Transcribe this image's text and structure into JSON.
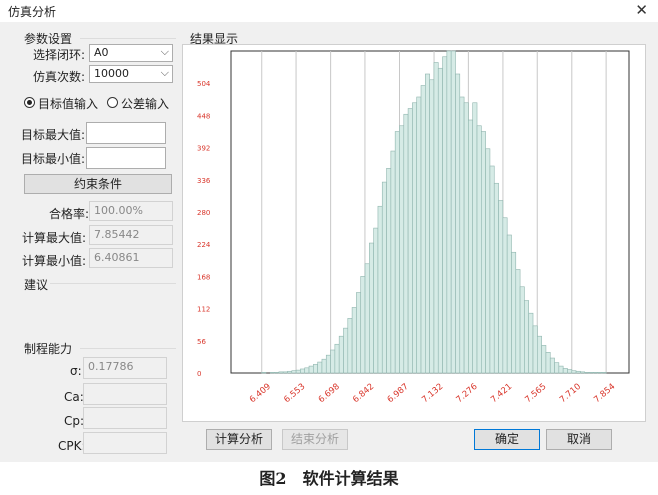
{
  "window": {
    "title": "仿真分析"
  },
  "params": {
    "heading": "参数设置",
    "loop_label": "选择闭环:",
    "loop_value": "A0",
    "count_label": "仿真次数:",
    "count_value": "10000",
    "radio_target": "目标值输入",
    "radio_tolerance": "公差输入",
    "target_max_label": "目标最大值:",
    "target_min_label": "目标最小值:",
    "constraint_button": "约束条件",
    "pass_rate_label": "合格率:",
    "pass_rate_value": "100.00%",
    "calc_max_label": "计算最大值:",
    "calc_max_value": "7.85442",
    "calc_min_label": "计算最小值:",
    "calc_min_value": "6.40861",
    "suggest_label": "建议"
  },
  "capability": {
    "heading": "制程能力",
    "sigma_label": "σ:",
    "sigma_value": "0.17786",
    "ca_label": "Ca:",
    "cp_label": "Cp:",
    "cpk_label": "CPK:"
  },
  "buttons": {
    "calc": "计算分析",
    "end": "结束分析",
    "ok": "确定",
    "cancel": "取消"
  },
  "results": {
    "heading": "结果显示"
  },
  "caption": {
    "fig": "图2",
    "text": "软件计算结果"
  },
  "chart_data": {
    "type": "bar",
    "title": "",
    "xlabel": "",
    "ylabel": "",
    "ylim": [
      0,
      560
    ],
    "xlim": [
      6.28,
      7.95
    ],
    "y_ticks": [
      0,
      56,
      112,
      168,
      224,
      280,
      336,
      392,
      448,
      504
    ],
    "x_ticks": [
      6.409,
      6.553,
      6.698,
      6.842,
      6.987,
      7.132,
      7.276,
      7.421,
      7.565,
      7.71,
      7.854
    ],
    "x_tick_labels": [
      "6.409",
      "6.553",
      "6.698",
      "6.842",
      "6.987",
      "7.132",
      "7.276",
      "7.421",
      "7.565",
      "7.710",
      "7.854"
    ],
    "bin_start": 6.40861,
    "bin_width": 0.018073,
    "values": [
      1,
      0,
      1,
      1,
      2,
      2,
      3,
      4,
      5,
      7,
      9,
      12,
      15,
      19,
      24,
      31,
      40,
      50,
      64,
      78,
      95,
      114,
      140,
      168,
      190,
      226,
      252,
      290,
      332,
      356,
      386,
      420,
      430,
      450,
      460,
      470,
      480,
      500,
      520,
      510,
      540,
      530,
      550,
      570,
      560,
      520,
      480,
      470,
      440,
      470,
      430,
      420,
      390,
      360,
      330,
      300,
      270,
      240,
      210,
      180,
      150,
      126,
      104,
      82,
      64,
      48,
      36,
      26,
      18,
      12,
      8,
      6,
      4,
      3,
      2,
      1,
      1,
      1,
      1,
      1
    ],
    "grid": true,
    "tick_color": "#d9362b",
    "bar_color": "#d6ebe6",
    "bar_edge": "#8fb5ae"
  }
}
